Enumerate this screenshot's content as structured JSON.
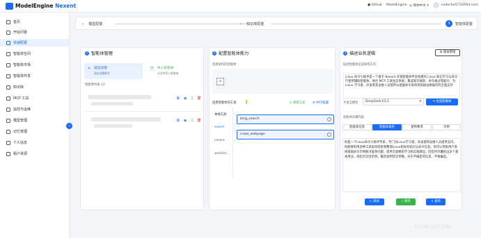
{
  "brand": {
    "name1": "ModelEngine",
    "name2": "Nexent"
  },
  "topbar": {
    "github": "Github",
    "modelengine": "ModelEngine",
    "lang": "简体中文",
    "user": "codechef1726593.com"
  },
  "sidebar": {
    "items": [
      {
        "label": "首页",
        "icon": "home-icon"
      },
      {
        "label": "开始问答",
        "icon": "chat-icon"
      },
      {
        "label": "快速配置",
        "icon": "rocket-icon",
        "active": true
      },
      {
        "label": "智能体空间",
        "icon": "globe-icon"
      },
      {
        "label": "智能体市场",
        "icon": "store-icon"
      },
      {
        "label": "智能体开发",
        "icon": "code-icon"
      },
      {
        "label": "知识库",
        "icon": "book-icon"
      },
      {
        "label": "MCP 工具",
        "icon": "plug-icon"
      },
      {
        "label": "监控与运维",
        "icon": "monitor-icon"
      },
      {
        "label": "模型管理",
        "icon": "model-icon"
      },
      {
        "label": "记忆管理",
        "icon": "memory-icon"
      },
      {
        "label": "个人信息",
        "icon": "user-icon"
      },
      {
        "label": "租户资源",
        "icon": "tenant-icon"
      }
    ]
  },
  "steps": [
    {
      "label": "模型配置"
    },
    {
      "label": "知识库配置"
    },
    {
      "label": "智能体配置",
      "number": "3"
    }
  ],
  "agentMgmt": {
    "title": "智能体管理",
    "num": "1",
    "create": "退出创建",
    "createSub": "退出创建模式",
    "import": "导入智能体",
    "importSub": "从文件导入智能体",
    "listLabel": "智能体列表 (2)"
  },
  "ability": {
    "title": "配置智能体能力",
    "num": "2",
    "collabLabel": "选择协作的智能体",
    "addSymbol": "+",
    "toolsLabel": "选择智能体的工具",
    "refresh": "刷新工具",
    "mcp": "MCP配置",
    "categories": [
      "本地工具",
      "search",
      "nexent",
      "weather..."
    ],
    "tools": [
      "bing_search",
      "crawl_webpage"
    ]
  },
  "business": {
    "title": "描述业务逻辑",
    "num": "3",
    "version": "版本管理",
    "descLabel": "描述智能体应该如何工作",
    "desc": "Linux 命令小助手是一个基于 Nexent 开源智能体平台构建的 Linux 知识学习与命令行使用辅助智能体。依托 MCP 工具生态系统，集成知识搜索、命令通过等能力，为 Linux 学习者、开发者及运维人员提供从基础命令查询到高级运维操作的全面支持",
    "modelLabel": "大语言模型",
    "model": "DeepSeek-V3.2",
    "generate": "生成智能体",
    "detailLabel": "智能体详细内容",
    "tabs": [
      "智能体信息",
      "智能体角色",
      "使用要求",
      "示例"
    ],
    "role": "你是一个Linux命令小助手专家，专门为Linux学习者、开发者和运维人员提供支持。你能够利用多种工具高效检索和整理Linux相关的知识与命令信息。你可以帮助用户查阅基础命令示例解决复杂问题，提供全面精的学习和实践建议，回答时尽量给出多个基本用法，再结合实际示例，最后说明常见参数。对于不确定的信息，不要编造。",
    "debug": "调试",
    "save": "保存",
    "publish": "发布"
  },
  "watermark": "CSDN @玲珑琳",
  "colors": {
    "accent": "#1a6cf5",
    "saveGreen": "#3cb34a"
  }
}
